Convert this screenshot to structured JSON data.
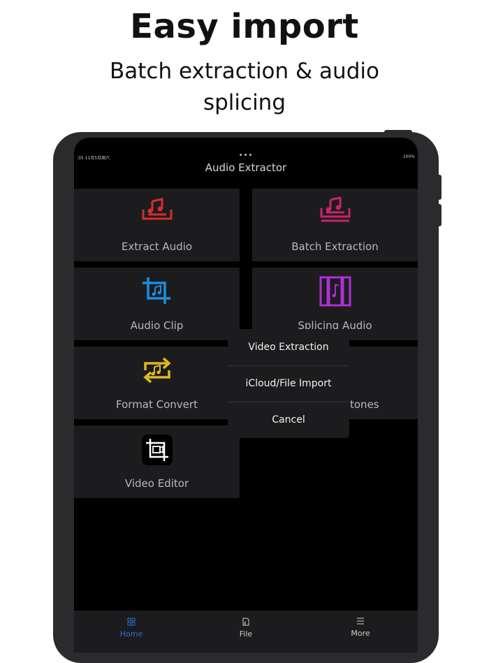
{
  "promo": {
    "headline": "Easy import",
    "subheadline_line1": "Batch extraction & audio",
    "subheadline_line2": "splicing"
  },
  "status_bar": {
    "time": ":35  11月5日周六",
    "right": "100%"
  },
  "app": {
    "title": "Audio Extractor",
    "more_dots": "•••"
  },
  "tiles": [
    {
      "label": "Extract Audio",
      "icon": "music-tray-icon",
      "color": "#d62d2d"
    },
    {
      "label": "Batch Extraction",
      "icon": "music-tray-stack-icon",
      "color": "#c8236c"
    },
    {
      "label": "Audio Clip",
      "icon": "crop-music-icon",
      "color": "#1a8ee0"
    },
    {
      "label": "Splicing Audio",
      "icon": "splice-columns-icon",
      "color": "#b02ed6"
    },
    {
      "label": "Format Convert",
      "icon": "convert-arrows-icon",
      "color": "#e0b81e"
    },
    {
      "label": "tones",
      "icon": "ringtone-icon",
      "color": "#888888"
    },
    {
      "label": "Video Editor",
      "icon": "video-crop-icon",
      "color": "#ffffff"
    }
  ],
  "popover": {
    "items": [
      "Video Extraction",
      "iCloud/File Import",
      "Cancel"
    ]
  },
  "bottom_nav": {
    "items": [
      {
        "label": "Home",
        "icon": "grid-icon",
        "active": true
      },
      {
        "label": "File",
        "icon": "file-icon",
        "active": false
      },
      {
        "label": "More",
        "icon": "list-icon",
        "active": false
      }
    ],
    "active_color": "#2f6fd6",
    "inactive_color": "#cfcfcf"
  }
}
